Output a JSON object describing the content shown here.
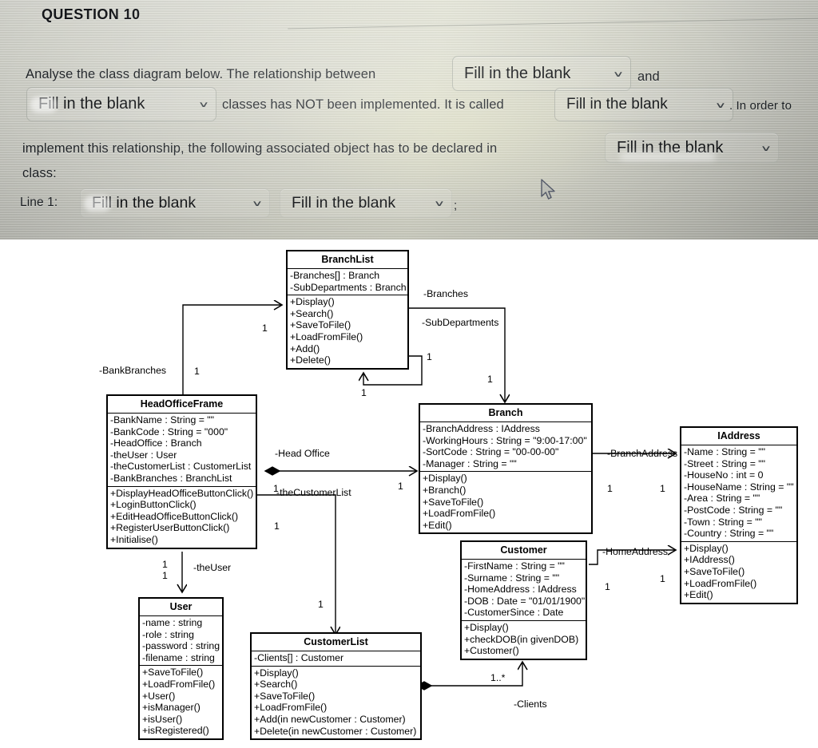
{
  "quiz": {
    "question_heading": "QUESTION 10",
    "dropdown_label": "Fill in the blank",
    "chevron": "∨",
    "text": {
      "part1": "Analyse the class diagram below. The relationship between",
      "part2": "and",
      "part3": "classes has NOT been implemented. It is called",
      "part4": ". In order to",
      "part5": "implement this relationship, the following associated object has to be declared in",
      "part6": "class:",
      "line_label": "Line 1:",
      "semicolon": ";"
    }
  },
  "diagram": {
    "classes": [
      {
        "id": "branchlist",
        "name": "BranchList",
        "attributes": [
          "-Branches[] : Branch",
          "-SubDepartments : Branch"
        ],
        "operations": [
          "+Display()",
          "+Search()",
          "+SaveToFile()",
          "+LoadFromFile()",
          "+Add()",
          "+Delete()"
        ]
      },
      {
        "id": "headofficeframe",
        "name": "HeadOfficeFrame",
        "attributes": [
          "-BankName : String = \"\"",
          "-BankCode : String = \"000\"",
          "-HeadOffice : Branch",
          "-theUser : User",
          "-theCustomerList : CustomerList",
          "-BankBranches : BranchList"
        ],
        "operations": [
          "+DisplayHeadOfficeButtonClick()",
          "+LoginButtonClick()",
          "+EditHeadOfficeButtonClick()",
          "+RegisterUserButtonClick()",
          "+Initialise()"
        ]
      },
      {
        "id": "branch",
        "name": "Branch",
        "attributes": [
          "-BranchAddress : IAddress",
          "-WorkingHours : String = \"9:00-17:00\"",
          "-SortCode : String = \"00-00-00\"",
          "-Manager : String = \"\""
        ],
        "operations": [
          "+Display()",
          "+Branch()",
          "+SaveToFile()",
          "+LoadFromFile()",
          "+Edit()"
        ]
      },
      {
        "id": "iaddress",
        "name": "IAddress",
        "attributes": [
          "-Name : String = \"\"",
          "-Street : String = \"\"",
          "-HouseNo : int = 0",
          "-HouseName : String = \"\"",
          "-Area : String = \"\"",
          "-PostCode : String = \"\"",
          "-Town : String = \"\"",
          "-Country : String = \"\""
        ],
        "operations": [
          "+Display()",
          "+IAddress()",
          "+SaveToFile()",
          "+LoadFromFile()",
          "+Edit()"
        ]
      },
      {
        "id": "customer",
        "name": "Customer",
        "attributes": [
          "-FirstName : String = \"\"",
          "-Surname : String = \"\"",
          "-HomeAddress : IAddress",
          "-DOB : Date = \"01/01/1900\"",
          "-CustomerSince : Date"
        ],
        "operations": [
          "+Display()",
          "+checkDOB(in givenDOB)",
          "+Customer()"
        ]
      },
      {
        "id": "user",
        "name": "User",
        "attributes": [
          "-name : string",
          "-role : string",
          "-password : string",
          "-filename : string"
        ],
        "operations": [
          "+SaveToFile()",
          "+LoadFromFile()",
          "+User()",
          "+isManager()",
          "+isUser()",
          "+isRegistered()"
        ]
      },
      {
        "id": "customerlist",
        "name": "CustomerList",
        "attributes": [
          "-Clients[] : Customer"
        ],
        "operations": [
          "+Display()",
          "+Search()",
          "+SaveToFile()",
          "+LoadFromFile()",
          "+Add(in newCustomer : Customer)",
          "+Delete(in newCustomer : Customer)"
        ]
      }
    ],
    "edge_labels": {
      "bank_branches": "-BankBranches",
      "branches": "-Branches",
      "sub_departments": "-SubDepartments",
      "head_office": "-Head Office",
      "the_customer_list": "-theCustomerList",
      "the_user": "-theUser",
      "branch_address": "-BranchAddress",
      "home_address": "-HomeAddress",
      "clients": "-Clients"
    },
    "multiplicities": {
      "one": "1",
      "one_to_many": "1..*"
    }
  }
}
